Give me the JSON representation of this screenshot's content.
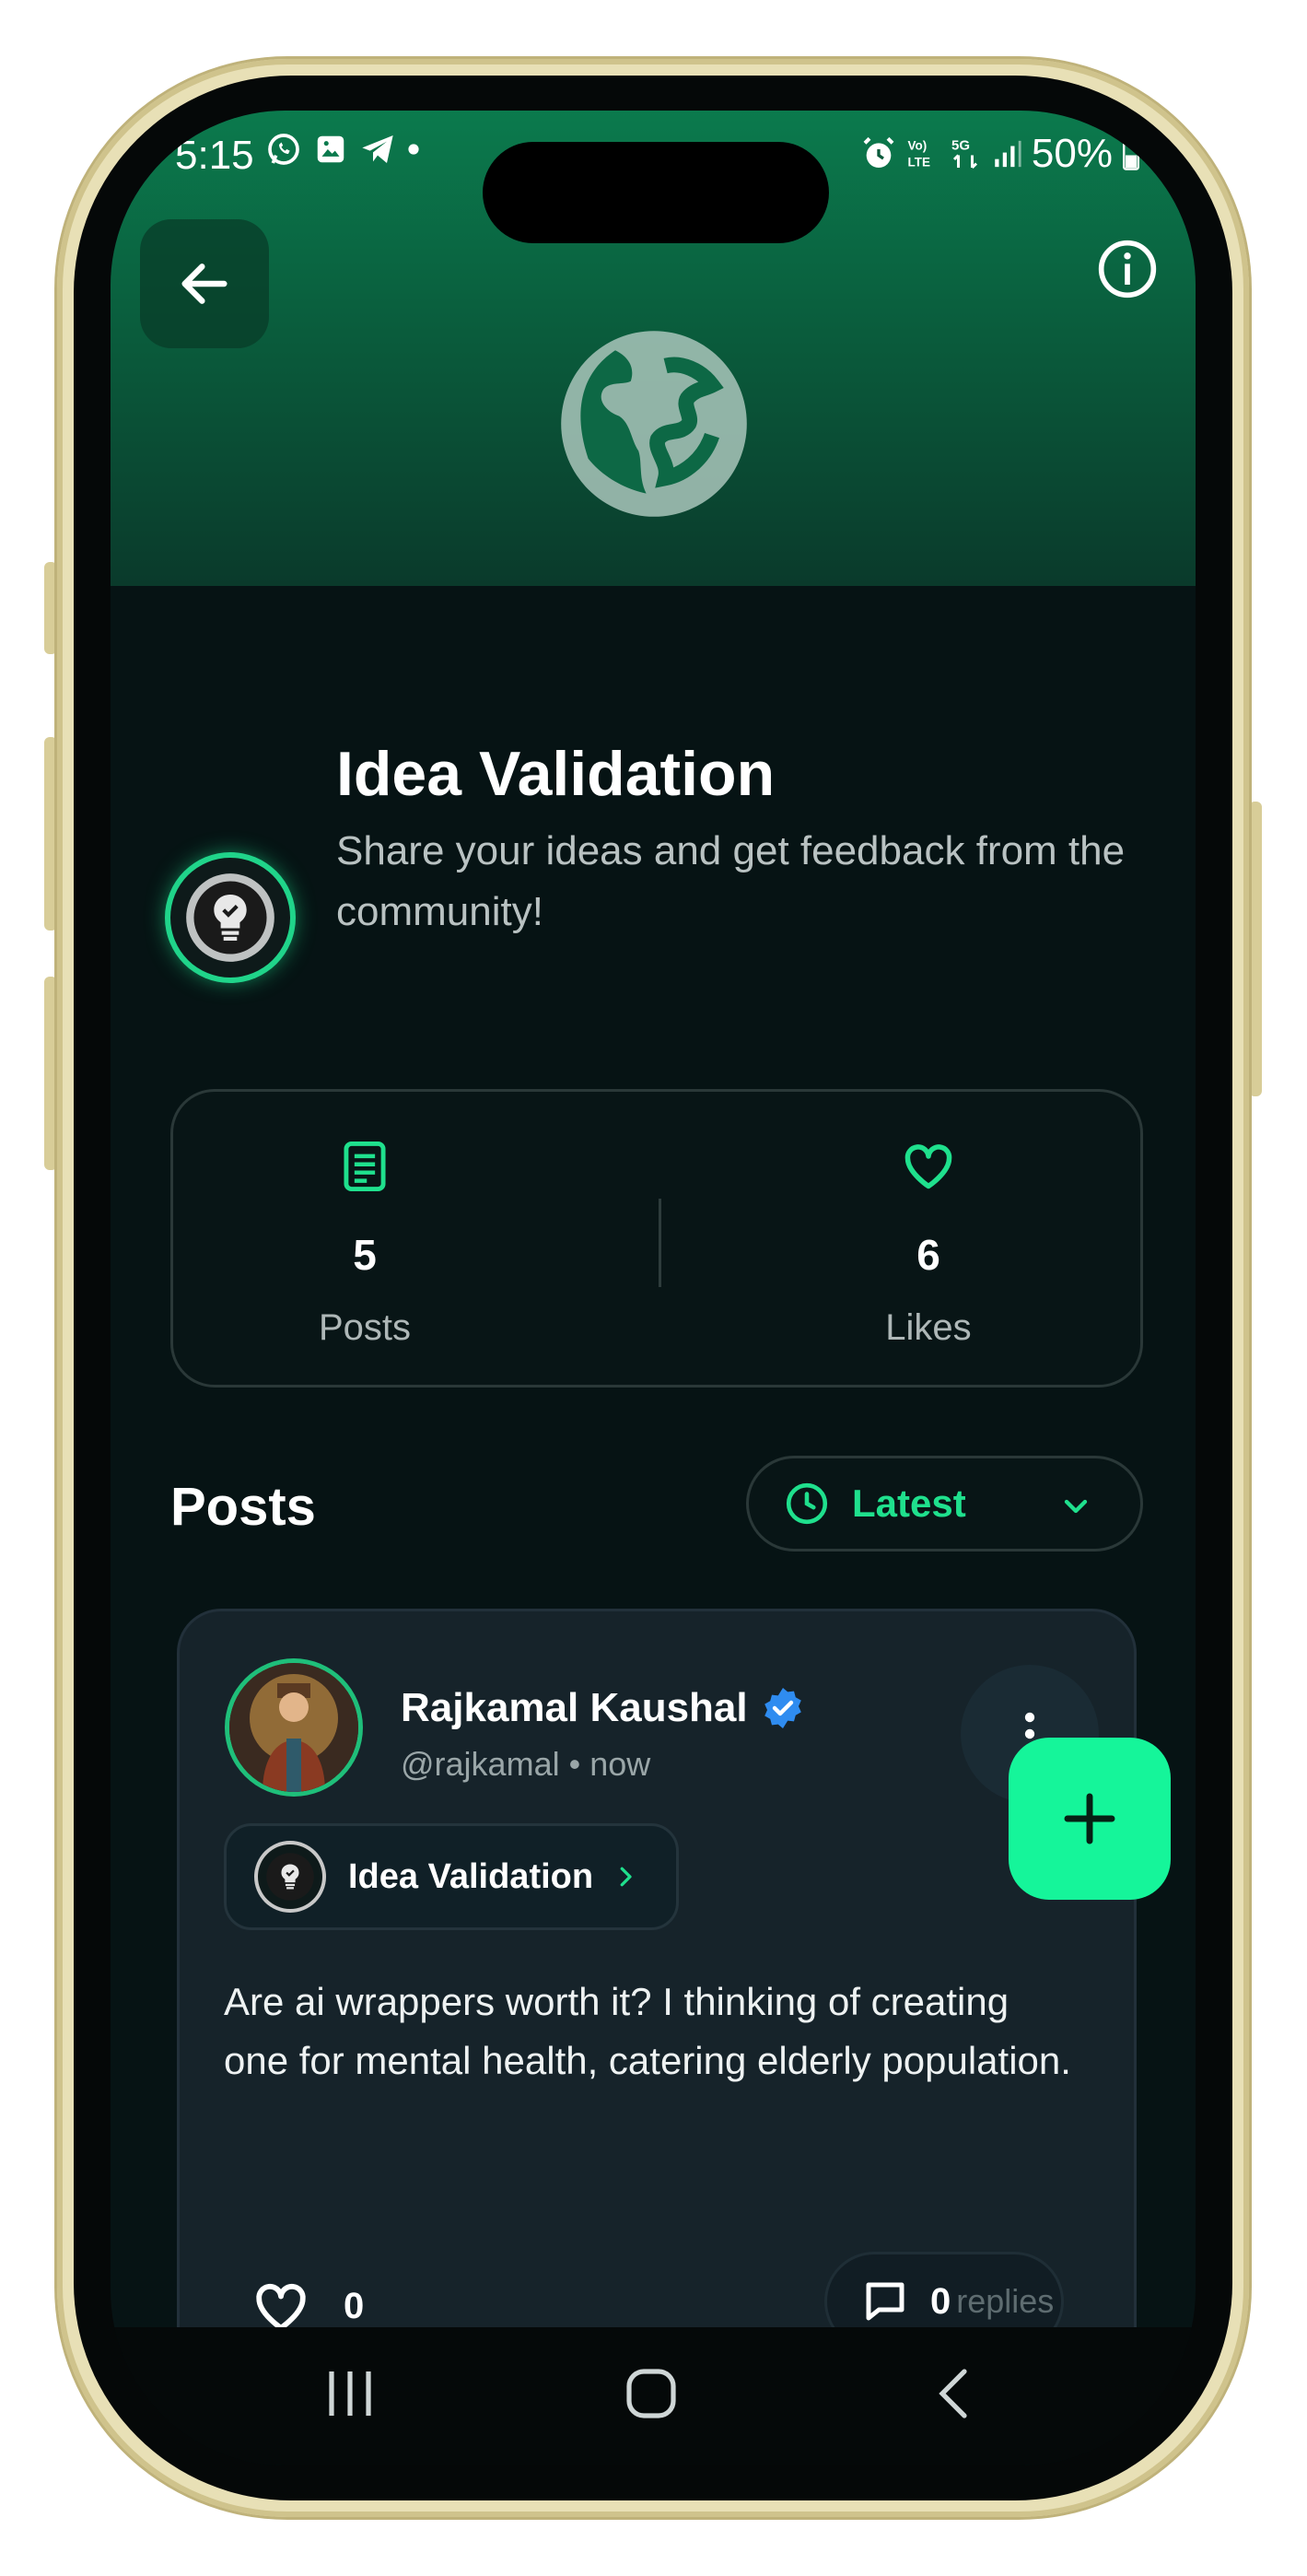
{
  "status_bar": {
    "time": "5:15",
    "battery": "50%"
  },
  "header": {
    "back_icon": "arrow-left-icon",
    "info_icon": "info-icon",
    "cover_icon": "globe-icon"
  },
  "community": {
    "name": "Idea Validation",
    "description": " Share your ideas and get feedback from the community!",
    "avatar_icon": "lightbulb-icon"
  },
  "stats": {
    "posts": {
      "value": "5",
      "label": "Posts",
      "icon": "document-icon"
    },
    "likes": {
      "value": "6",
      "label": "Likes",
      "icon": "heart-icon"
    }
  },
  "posts_section": {
    "heading": "Posts",
    "sort_label": "Latest"
  },
  "post": {
    "author_name": "Rajkamal Kaushal",
    "handle": "@rajkamal • now",
    "community_chip": "Idea Validation",
    "body": "Are ai wrappers worth it? I thinking of creating one for mental health, catering elderly population.",
    "likes": "0",
    "replies": "0",
    "replies_word": "replies"
  },
  "colors": {
    "accent": "#1fe08d",
    "fab": "#15f59a",
    "background": "#061314",
    "card": "#16232a"
  }
}
